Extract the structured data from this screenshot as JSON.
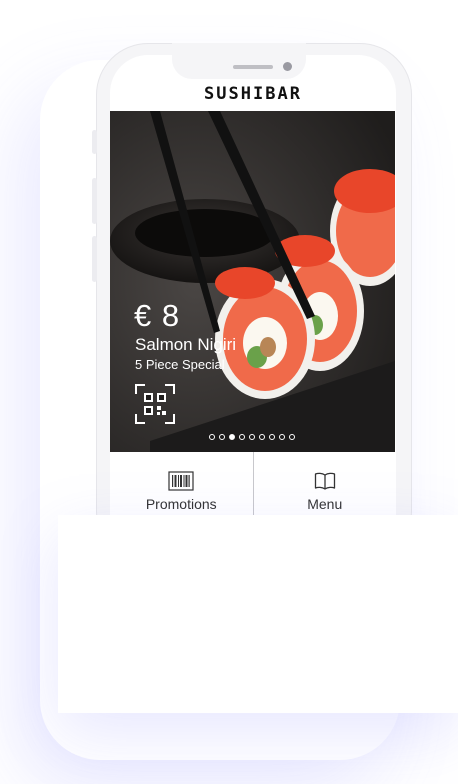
{
  "brand": {
    "name": "SUSHIBAR"
  },
  "hero": {
    "price": "€ 8",
    "dish_name": "Salmon Nigiri",
    "dish_subtitle": "5 Piece Special",
    "qr_icon": "qr-scan-icon",
    "carousel_count": 9,
    "carousel_active": 3
  },
  "tabs": [
    {
      "label": "Promotions",
      "icon": "barcode-icon"
    },
    {
      "label": "Menu",
      "icon": "book-icon"
    }
  ],
  "colors": {
    "salmon": "#f06a4a",
    "roe": "#e8462a",
    "dark": "#2c2a29",
    "accent_shadow": "#7878ff"
  }
}
